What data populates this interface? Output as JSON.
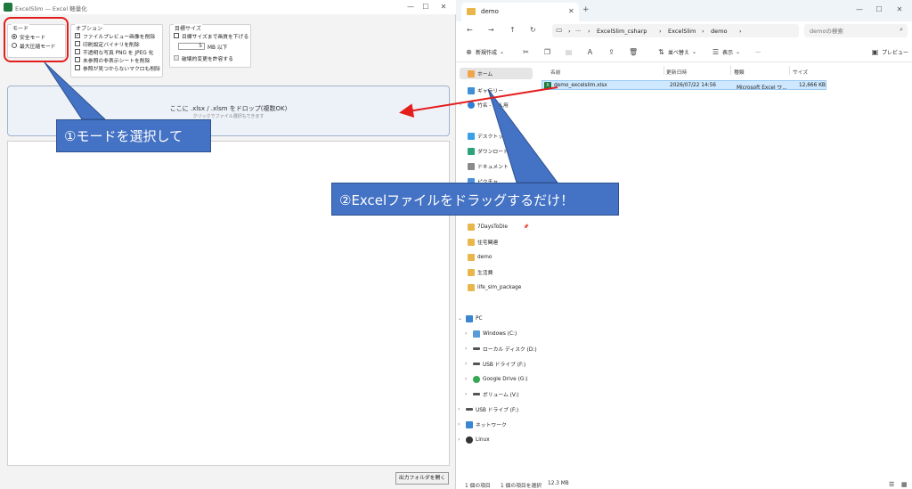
{
  "colors": {
    "accent": "#4472c4",
    "highlight": "#e41d1d",
    "arrow": "#e41d1d",
    "excel_green": "#1d7a3c"
  },
  "left_window": {
    "title": "ExcelSlim — Excel 軽量化",
    "controls": {
      "minimize": "—",
      "maximize": "☐",
      "close": "✕"
    },
    "mode_group": {
      "title": "モード",
      "options": [
        {
          "label": "安全モード",
          "selected": true
        },
        {
          "label": "最大圧縮モード",
          "selected": false
        }
      ]
    },
    "options_group": {
      "title": "オプション",
      "items": [
        {
          "label": "ファイルプレビュー画像を削除",
          "checked": true
        },
        {
          "label": "印刷設定バイナリを削除",
          "checked": false
        },
        {
          "label": "不透明な写真 PNG を JPEG 化",
          "checked": false
        },
        {
          "label": "未参照の非表示シートを削除",
          "checked": false
        },
        {
          "label": "参照が見つからないマクロも削除",
          "checked": false
        }
      ]
    },
    "target_group": {
      "title": "目標サイズ",
      "reduce_label": "目標サイズまで画質を下げる",
      "reduce_checked": false,
      "size_value": "5",
      "size_unit": "MB 以下",
      "allow_label": "破壊的変更を許容する",
      "allow_checked": false
    },
    "drop_zone": {
      "main": "ここに .xlsx / .xlsm をドロップ(複数OK)",
      "sub": "クリックでファイル選択もできます"
    },
    "open_folder_button": "出力フォルダを開く"
  },
  "explorer": {
    "tab_title": "demo",
    "breadcrumb": [
      "ExcelSlim_csharp",
      "ExcelSlim",
      "demo"
    ],
    "search_placeholder": "demoの検索",
    "toolbar": {
      "new": "新規作成",
      "sort": "並べ替え",
      "view": "表示",
      "more": "…",
      "preview": "プレビュー"
    },
    "nav": {
      "home": "ホーム",
      "gallery": "ギャラリー",
      "personal": "竹名 - 個人用",
      "desktop": "デスクトップ",
      "downloads": "ダウンロード",
      "documents": "ドキュメント",
      "pictures": "ピクチャ",
      "folder_1": "7DaysToDie",
      "folder_2": "住宅関連",
      "folder_3": "demo",
      "folder_4": "生活費",
      "folder_5": "life_sim_package",
      "pc": "PC",
      "drive_c": "Windows (C:)",
      "drive_d": "ローカル ディスク (D:)",
      "drive_f": "USB ドライブ (F:)",
      "drive_g": "Google Drive (G:)",
      "drive_v": "ボリューム (V:)",
      "usb": "USB ドライブ (F:)",
      "network": "ネットワーク",
      "linux": "Linux"
    },
    "columns": {
      "name": "名前",
      "modified": "更新日時",
      "type": "種類",
      "size": "サイズ"
    },
    "files": [
      {
        "name": "demo_excelslim.xlsx",
        "modified": "2026/07/22 14:56",
        "type": "Microsoft Excel ワ...",
        "size": "12,666 KB"
      }
    ],
    "status": {
      "count": "1 個の項目",
      "selected": "1 個の項目を選択",
      "size": "12.3 MB"
    }
  },
  "annotations": {
    "step1": "①モードを選択して",
    "step2": "②Excelファイルをドラッグするだけ！"
  }
}
